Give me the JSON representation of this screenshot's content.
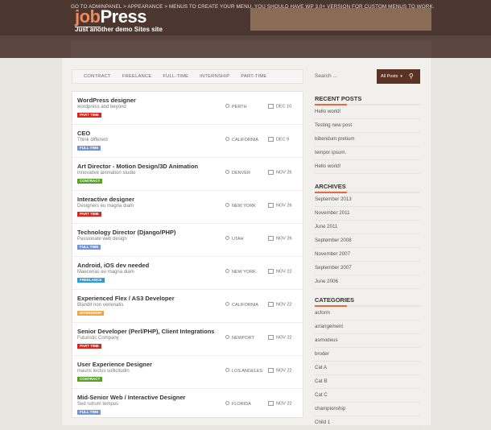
{
  "header": {
    "logo_prefix": "job",
    "logo_suffix": "Press",
    "tagline": "Just another demo Sites site"
  },
  "notice": "Go to Adminpanel > Appearance > Menus to create your menu. You should have WP 3.0+ version for custom menus to work.",
  "tabs": [
    "Contract",
    "Freelance",
    "Full-Time",
    "Internship",
    "Part-Time"
  ],
  "jobs": [
    {
      "title": "WordPress designer",
      "company": "wordpress and beyond",
      "type": "Part Time",
      "type_color": "#d9261c",
      "location": "Perth",
      "date": "Dec 10"
    },
    {
      "title": "CEO",
      "company": "Think different",
      "type": "Full Time",
      "type_color": "#7393d3",
      "location": "California",
      "date": "Dec 9"
    },
    {
      "title": "Art Director - Motion Design/3D Animation",
      "company": "innovative animation studio",
      "type": "Contract",
      "type_color": "#5a9e2a",
      "location": "Denver",
      "date": "Nov 26"
    },
    {
      "title": "Interactive designer",
      "company": "Designers eu magna diam",
      "type": "Part Time",
      "type_color": "#d9261c",
      "location": "New York",
      "date": "Nov 26"
    },
    {
      "title": "Technology Director (Django/PHP)",
      "company": "Passionate web design",
      "type": "Full Time",
      "type_color": "#7393d3",
      "location": "Utah",
      "date": "Nov 26"
    },
    {
      "title": "Android, iOS dev needed",
      "company": "Maecenas eu magna diam",
      "type": "Freelance",
      "type_color": "#2c9bd7",
      "location": "New York",
      "date": "Nov 22"
    },
    {
      "title": "Experienced Flex / AS3 Developer",
      "company": "Blandit non venenatis",
      "type": "Internship",
      "type_color": "#e9a650",
      "location": "California",
      "date": "Nov 22"
    },
    {
      "title": "Senior Developer (Perl/PHP), Client Integrations",
      "company": "Futuristic Company",
      "type": "Part Time",
      "type_color": "#d9261c",
      "location": "Newport",
      "date": "Nov 22"
    },
    {
      "title": "User Experience Designer",
      "company": "mauris lectus sollicitudin",
      "type": "Contract",
      "type_color": "#5a9e2a",
      "location": "Los Angeles",
      "date": "Nov 22"
    },
    {
      "title": "Mid-Senior Web / Interactive Designer",
      "company": "Sed rutrum tempus",
      "type": "Full Time",
      "type_color": "#7393d3",
      "location": "Florida",
      "date": "Nov 22"
    }
  ],
  "sidebar": {
    "search_placeholder": "Search ...",
    "search_option": "All Posts",
    "recent_title": "Recent Posts",
    "recent": [
      "Hello world!",
      "Testing new post",
      "bibendum pretium",
      "tempor ipsum.",
      "Hello world!"
    ],
    "archives_title": "Archives",
    "archives": [
      "September 2013",
      "November 2011",
      "June 2011",
      "September 2008",
      "November 2007",
      "September 2007",
      "June 2006"
    ],
    "categories_title": "Categories",
    "categories": [
      "acform",
      "arrangement",
      "asmodeus",
      "broder",
      "Cat A",
      "Cat B",
      "Cat C",
      "championship",
      "Child 1"
    ]
  },
  "icons": {
    "location": "pin-icon",
    "date": "calendar-icon",
    "search": "search-icon"
  }
}
